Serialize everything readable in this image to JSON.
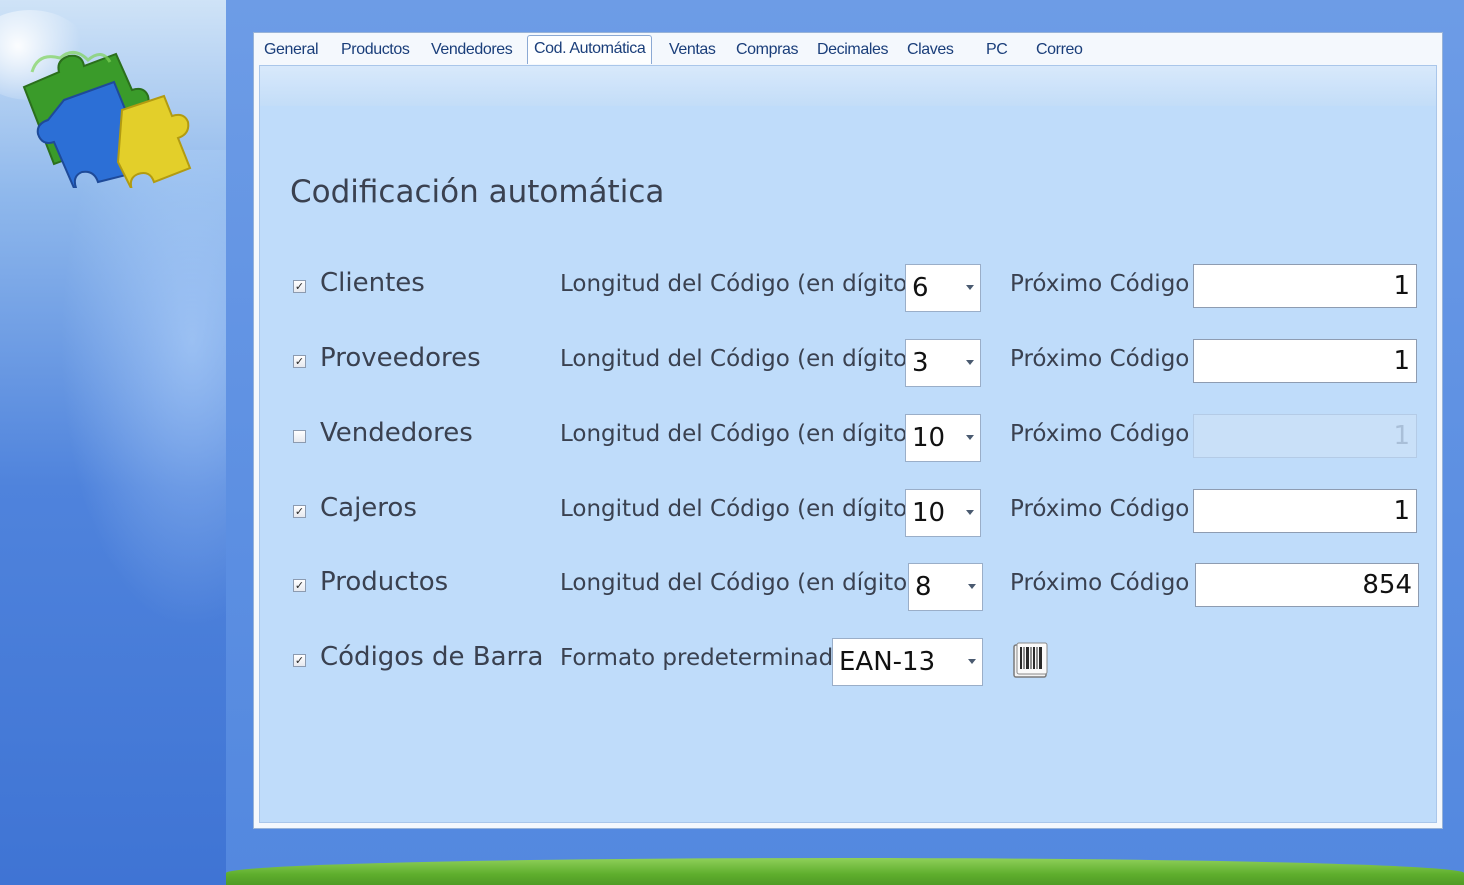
{
  "tabs": [
    {
      "label": "General",
      "active": false
    },
    {
      "label": "Productos",
      "active": false
    },
    {
      "label": "Vendedores",
      "active": false
    },
    {
      "label": "Cod. Automática",
      "active": true
    },
    {
      "label": "Ventas",
      "active": false
    },
    {
      "label": "Compras",
      "active": false
    },
    {
      "label": "Decimales",
      "active": false
    },
    {
      "label": "Claves",
      "active": false
    },
    {
      "label": "PC",
      "active": false
    },
    {
      "label": "Correo",
      "active": false
    }
  ],
  "section_title": "Codificación automática",
  "rows": [
    {
      "label": "Clientes",
      "checked": true,
      "length_label": "Longitud del Código (en dígitos)",
      "length": "6",
      "next_label": "Próximo Código",
      "next_code": "1",
      "enabled": true
    },
    {
      "label": "Proveedores",
      "checked": true,
      "length_label": "Longitud del Código (en dígitos)",
      "length": "3",
      "next_label": "Próximo Código",
      "next_code": "1",
      "enabled": true
    },
    {
      "label": "Vendedores",
      "checked": false,
      "length_label": "Longitud del Código (en dígitos)",
      "length": "10",
      "next_label": "Próximo Código",
      "next_code": "1",
      "enabled": false
    },
    {
      "label": "Cajeros",
      "checked": true,
      "length_label": "Longitud del Código (en dígitos)",
      "length": "10",
      "next_label": "Próximo Código",
      "next_code": "1",
      "enabled": true
    },
    {
      "label": "Productos",
      "checked": true,
      "length_label": "Longitud del Código (en dígitos)",
      "length": "8",
      "next_label": "Próximo Código",
      "next_code": "854",
      "enabled": true
    }
  ],
  "barcode": {
    "label": "Códigos de Barra",
    "checked": true,
    "format_label": "Formato predeterminado",
    "format": "EAN-13",
    "icon": "barcode-icon"
  },
  "check_mark": "✓"
}
